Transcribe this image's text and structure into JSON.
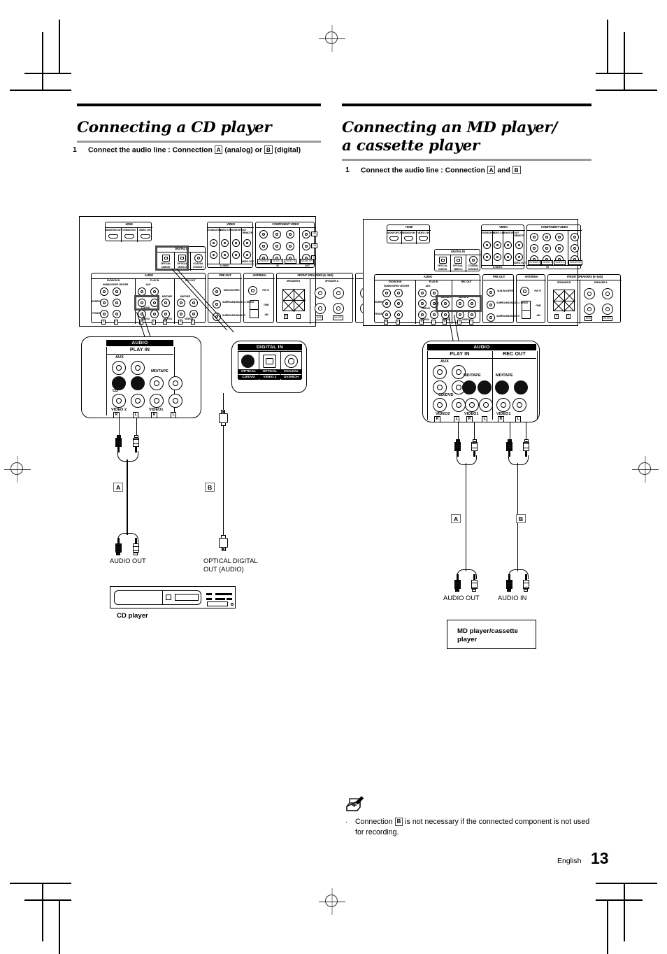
{
  "page": {
    "language": "English",
    "number": "13"
  },
  "left_section": {
    "title": "Connecting a CD player",
    "step_number": "1",
    "step_text_1": "Connect the audio line : Connection",
    "tag_a": "A",
    "step_text_2": "(analog) or",
    "tag_b": "B",
    "step_text_3": "(digital)"
  },
  "right_section": {
    "title_line1": "Connecting an MD player/",
    "title_line2": "a cassette player",
    "step_number": "1",
    "step_text_1": "Connect the audio line : Connection",
    "tag_a": "A",
    "step_text_2": "and",
    "tag_b": "B"
  },
  "rear_panel": {
    "hdmi": {
      "title": "HDMI",
      "ports": [
        "MONITOR OUT",
        "DVD/6CH IN",
        "VIDEO 2 IN"
      ]
    },
    "digital_in": {
      "title": "DIGITAL IN",
      "ports": [
        {
          "type": "OPTICAL",
          "source": "CD/DVD"
        },
        {
          "type": "OPTICAL",
          "source": "VIDEO 2"
        },
        {
          "type": "COAXIAL",
          "source": "DVD/6CH"
        }
      ]
    },
    "video": {
      "title": "VIDEO",
      "columns": [
        "DVD/6CH IN",
        "VIDEO 2 IN",
        "MONITOR OUT",
        "REMOTE"
      ],
      "svideo": "S-VIDEO",
      "video_out": "VIDEO OUT"
    },
    "component_video": {
      "title": "COMPONENT VIDEO",
      "rows": [
        "CR",
        "CB",
        "Y"
      ],
      "in": "IN",
      "out": "OUT",
      "columns": [
        "DVD/6CH",
        "VIDEO 1",
        "VIDEO 3",
        "MONITOR"
      ]
    },
    "audio": {
      "title": "AUDIO",
      "dvd6ch_in": "DVD/6CH IN",
      "play_in": "PLAY IN",
      "rec_out": "REC OUT",
      "rows": [
        "SUBWOOFER",
        "CENTER",
        "SURROUND",
        "FRONT"
      ],
      "sources": [
        "AUX",
        "MD/TAPE",
        "CD/DVD",
        "VIDEO2",
        "VIDEO1"
      ],
      "channel_r": "R",
      "channel_l": "L"
    },
    "pre_out": {
      "title": "PRE OUT",
      "labels": [
        "SUB WOOFER",
        "SURROUND BACK L / MONO",
        "SURROUND BACK R"
      ]
    },
    "antenna": {
      "title": "ANTENNA",
      "fm": "FM 75",
      "gnd": "GND",
      "am": "AM"
    },
    "speakers": {
      "title": "FRONT SPEAKERS (6~16Ω)",
      "speaker_b": "SPEAKER B",
      "speaker_a": "SPEAKER A",
      "channel_r": "R",
      "channel_l": "L",
      "red": "RED",
      "white": "WHITE"
    }
  },
  "left_callout_audio": {
    "head": "AUDIO",
    "play_in": "PLAY IN",
    "aux": "AUX",
    "md_tape": "MD/TAPE",
    "cd": "CD",
    "video2": "VIDEO 2",
    "video1": "VIDEO1",
    "r": "R",
    "l": "L"
  },
  "left_callout_digital": {
    "head": "DIGITAL IN",
    "ports": [
      {
        "type": "OPTICAL",
        "source": "CD/DVD"
      },
      {
        "type": "OPTICAL",
        "source": "VIDEO 2"
      },
      {
        "type": "COAXIAL",
        "source": "DVD/6CH"
      }
    ]
  },
  "right_callout_audio": {
    "head": "AUDIO",
    "play_in": "PLAY IN",
    "rec_out": "REC OUT",
    "aux": "AUX",
    "md_tape_play": "MD/TAPE",
    "md_tape_rec": "MD/TAPE",
    "cd_dvd": "CD/DVD",
    "video2": "VIDEO2",
    "video1_play": "VIDEO1",
    "video1_rec": "VIDEO1",
    "r": "R",
    "l": "L"
  },
  "left_cables": {
    "tag_a": "A",
    "tag_b": "B",
    "terminal_a": "AUDIO OUT",
    "terminal_b_line1": "OPTICAL DIGITAL",
    "terminal_b_line2": "OUT (AUDIO)",
    "device_name": "CD player"
  },
  "right_cables": {
    "tag_a": "A",
    "tag_b": "B",
    "terminal_a": "AUDIO OUT",
    "terminal_b": "AUDIO IN",
    "device_name_line1": "MD player/cassette",
    "device_name_line2": "player"
  },
  "note": {
    "icon": "pencil-memo-icon",
    "bullet": "·",
    "text_1": "Connection",
    "tag_b": "B",
    "text_2": "is not necessary if the connected component is not used for recording."
  }
}
